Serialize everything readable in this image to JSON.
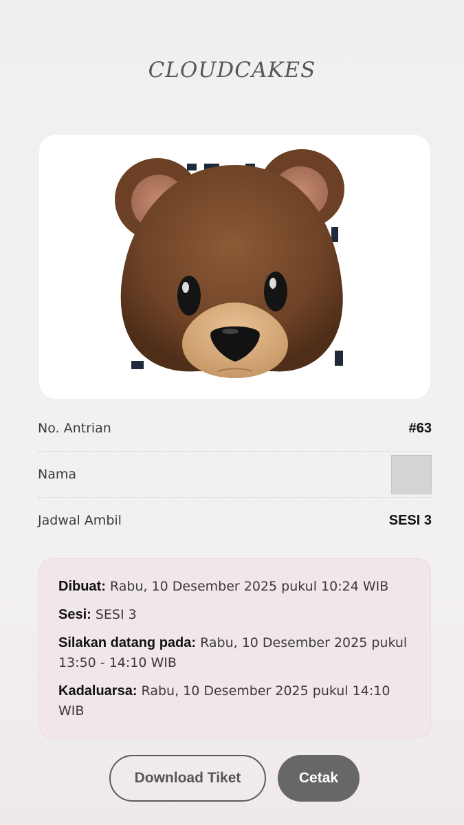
{
  "brand": {
    "name": "CLOUDCAKES"
  },
  "ticket": {
    "qr_image": "bear-emoji-over-qr",
    "rows": [
      {
        "label": "No. Antrian",
        "value": "#63"
      },
      {
        "label": "Nama",
        "value": ""
      },
      {
        "label": "Jadwal Ambil",
        "value": "SESI 3"
      }
    ]
  },
  "info": {
    "created_label": "Dibuat:",
    "created_value": " Rabu, 10 Desember 2025 pukul 10:24 WIB",
    "session_label": "Sesi:",
    "session_value": " SESI 3",
    "arrive_label": "Silakan datang pada:",
    "arrive_value": " Rabu, 10 Desember 2025 pukul 13:50 - 14:10 WIB",
    "expiry_label": "Kadaluarsa:",
    "expiry_value": " Rabu, 10 Desember 2025 pukul 14:10 WIB"
  },
  "buttons": {
    "download_label": "Download Tiket",
    "print_label": "Cetak"
  },
  "colors": {
    "info_bg": "#f1e6e8",
    "print_button_bg": "#676767",
    "bear_brown": "#7a4a2a",
    "bear_muzzle": "#d9ad7c"
  }
}
